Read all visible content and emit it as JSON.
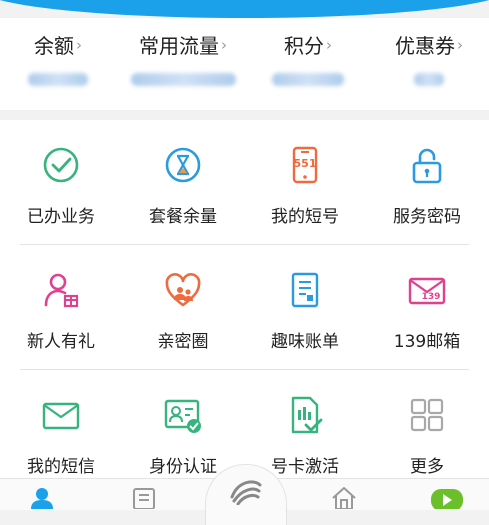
{
  "colors": {
    "accent": "#1aa1ea",
    "green": "#37b37e",
    "orange": "#ef6a3e",
    "pink": "#e0418f",
    "blue": "#2b9be0"
  },
  "stats": [
    {
      "label": "余额"
    },
    {
      "label": "常用流量"
    },
    {
      "label": "积分"
    },
    {
      "label": "优惠券"
    }
  ],
  "chevron": "›",
  "grid": [
    [
      {
        "label": "已办业务",
        "icon": "check-circle-icon"
      },
      {
        "label": "套餐余量",
        "icon": "hourglass-icon"
      },
      {
        "label": "我的短号",
        "icon": "phone-551-icon"
      },
      {
        "label": "服务密码",
        "icon": "lock-icon"
      }
    ],
    [
      {
        "label": "新人有礼",
        "icon": "user-gift-icon"
      },
      {
        "label": "亲密圈",
        "icon": "heart-people-icon"
      },
      {
        "label": "趣味账单",
        "icon": "bill-icon"
      },
      {
        "label": "139邮箱",
        "icon": "mail-139-icon"
      }
    ],
    [
      {
        "label": "我的短信",
        "icon": "envelope-icon"
      },
      {
        "label": "身份认证",
        "icon": "id-card-check-icon"
      },
      {
        "label": "号卡激活",
        "icon": "sim-card-check-icon"
      },
      {
        "label": "更多",
        "icon": "grid-more-icon"
      }
    ]
  ],
  "mail_badge": "139",
  "phone_badge": "551"
}
